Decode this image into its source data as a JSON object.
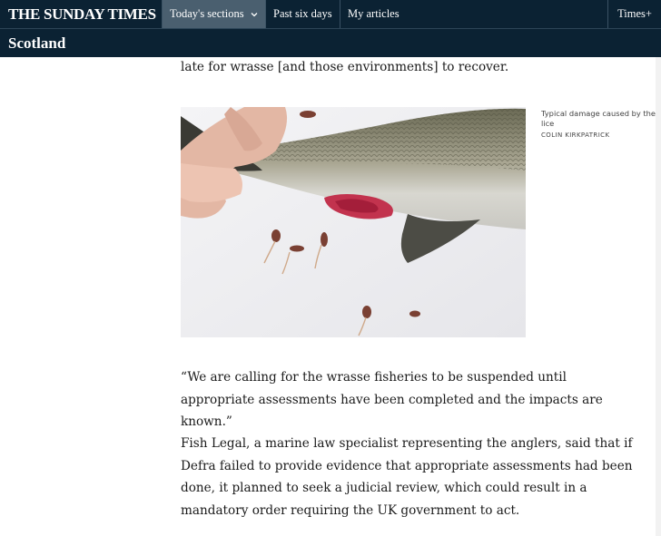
{
  "header": {
    "logo": "THE SUNDAY TIMES",
    "nav": {
      "sections_label": "Today's sections",
      "six_days_label": "Past six days",
      "my_articles_label": "My articles",
      "times_plus_label": "Times+"
    },
    "section_name": "Scotland"
  },
  "article": {
    "paragraph_0": "late for wrasse [and those environments] to recover.",
    "image": {
      "caption": "Typical damage caused by the lice",
      "credit": "COLIN KIRKPATRICK"
    },
    "paragraph_1": "“We are calling for the wrasse fisheries to be suspended until appropriate assessments have been completed and the impacts are known.”",
    "paragraph_2": "Fish Legal, a marine law specialist representing the anglers, said that if Defra failed to provide evidence that appropriate assessments had been done, it planned to seek a judicial review, which could result in a mandatory order requiring the UK government to act."
  },
  "colors": {
    "nav_background": "#0b2233",
    "nav_active": "#4a5f6f"
  }
}
